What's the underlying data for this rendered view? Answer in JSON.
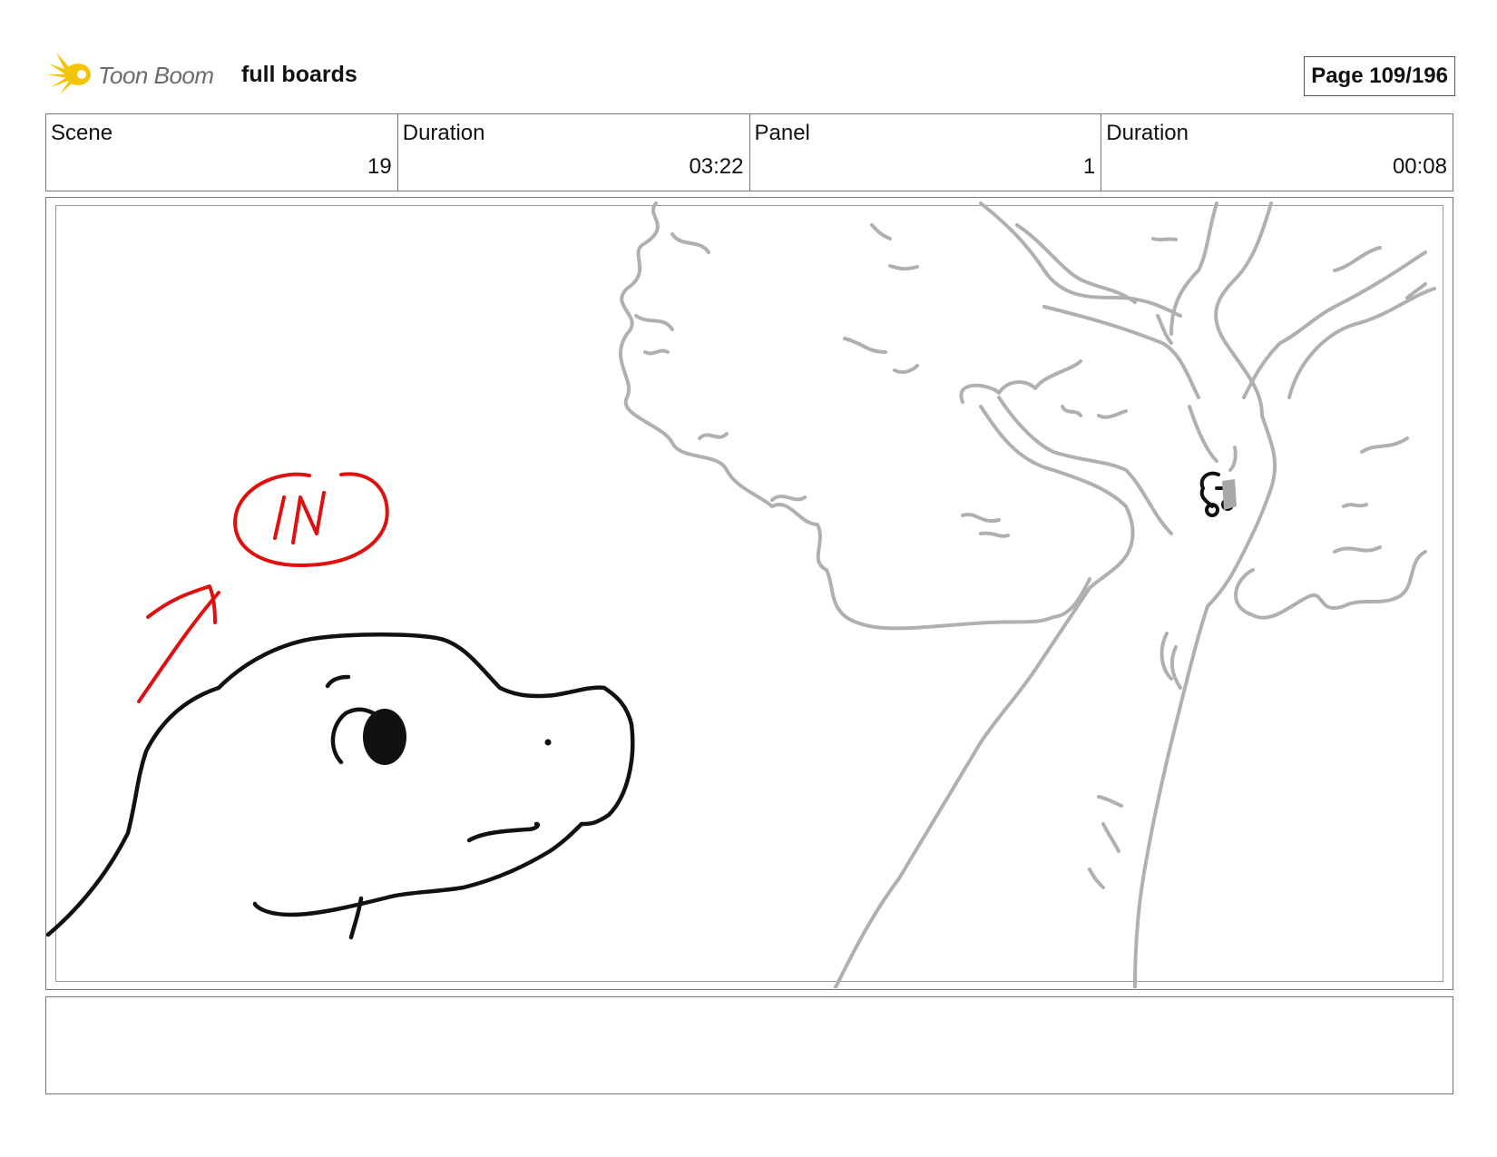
{
  "header": {
    "logo_text": "Toon Boom",
    "project_title": "full boards",
    "page_label": "Page 109/196"
  },
  "info": {
    "scene_label": "Scene",
    "scene_value": "19",
    "scene_duration_label": "Duration",
    "scene_duration_value": "03:22",
    "panel_label": "Panel",
    "panel_value": "1",
    "panel_duration_label": "Duration",
    "panel_duration_value": "00:08"
  },
  "panel": {
    "annotation_text": "IN"
  },
  "notes": {
    "text": ""
  },
  "colors": {
    "logo_yellow": "#f5c400",
    "annotation_red": "#e01010",
    "sketch_gray": "#b0b0b0",
    "ink_black": "#111111"
  }
}
